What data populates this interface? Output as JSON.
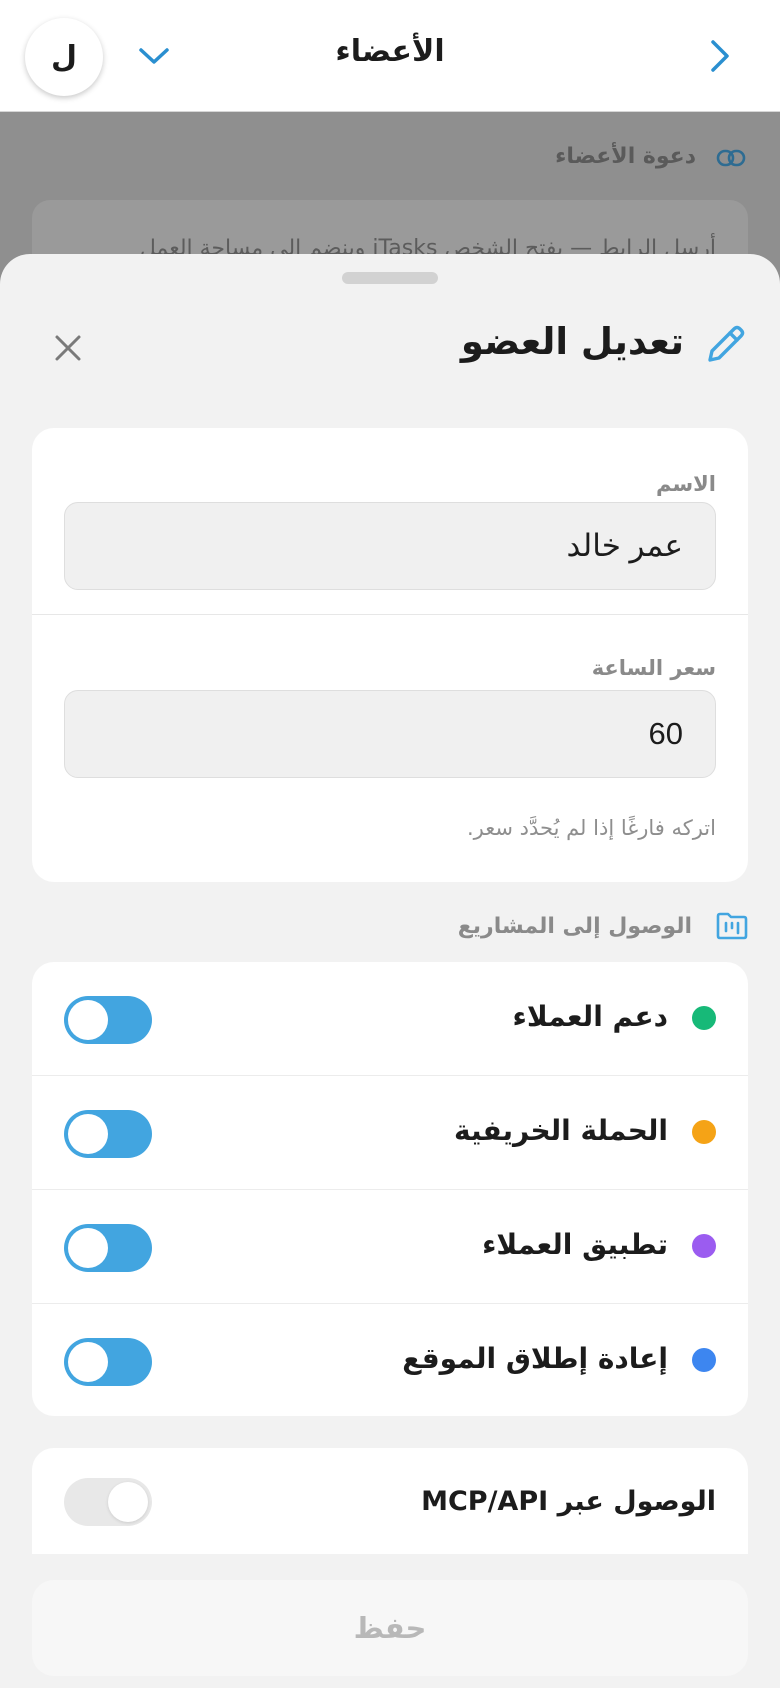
{
  "header": {
    "title": "الأعضاء",
    "avatar_letter": "ل"
  },
  "background": {
    "section_title": "دعوة الأعضاء",
    "card_text": "أرسل الرابط — يفتح الشخص iTasks وينضم إلى مساحة العمل"
  },
  "sheet": {
    "title": "تعديل العضو",
    "form": {
      "name_label": "الاسم",
      "name_value": "عمر خالد",
      "rate_label": "سعر الساعة",
      "rate_value": "60",
      "rate_hint": "اتركه فارغًا إذا لم يُحدَّد سعر."
    },
    "projects_title": "الوصول إلى المشاريع",
    "projects": [
      {
        "name": "دعم العملاء",
        "color": "#17b978",
        "enabled": true
      },
      {
        "name": "الحملة الخريفية",
        "color": "#f5a316",
        "enabled": true
      },
      {
        "name": "تطبيق العملاء",
        "color": "#9b5cf0",
        "enabled": true
      },
      {
        "name": "إعادة إطلاق الموقع",
        "color": "#3d86f0",
        "enabled": true
      }
    ],
    "mcp_label": "الوصول عبر MCP/API",
    "mcp_enabled": false,
    "save_label": "حفظ"
  },
  "colors": {
    "accent": "#42a5e0"
  }
}
